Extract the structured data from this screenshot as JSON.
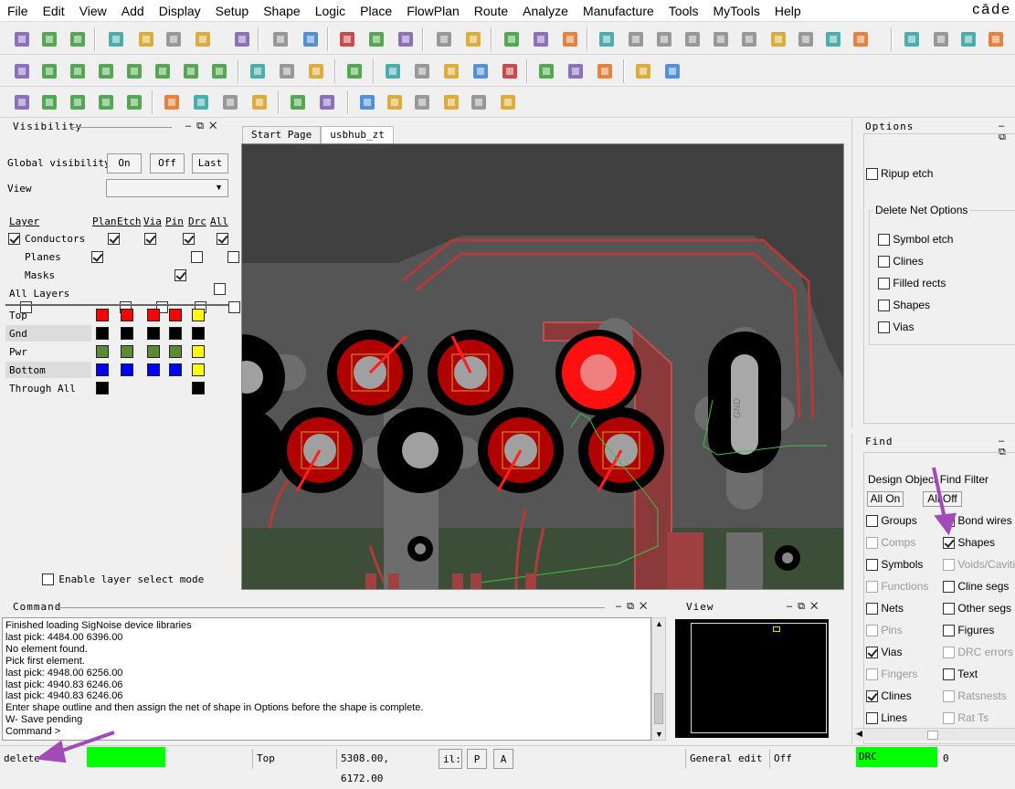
{
  "menu": [
    "File",
    "Edit",
    "View",
    "Add",
    "Display",
    "Setup",
    "Shape",
    "Logic",
    "Place",
    "FlowPlan",
    "Route",
    "Analyze",
    "Manufacture",
    "Tools",
    "MyTools",
    "Help"
  ],
  "brand": "cāde",
  "visibility": {
    "title": "Visibility",
    "global_label": "Global visibility",
    "btn_on": "On",
    "btn_off": "Off",
    "btn_last": "Last",
    "view_label": "View",
    "view_value": "",
    "columns": [
      "Layer",
      "Plan",
      "Etch",
      "Via",
      "Pin",
      "Drc",
      "All"
    ],
    "groups": [
      {
        "label": "Conductors",
        "checked": true,
        "cols": [
          true,
          true,
          true,
          true,
          true,
          true
        ]
      },
      {
        "label": "Planes",
        "checked": true,
        "cols": [
          false,
          false,
          false,
          false,
          false,
          false
        ]
      },
      {
        "label": "Masks",
        "checked": true,
        "cols": [
          false,
          false,
          false,
          false,
          false,
          false
        ]
      },
      {
        "label": "All Layers",
        "checked": false,
        "cols": [
          false,
          false,
          false,
          false,
          false,
          false
        ]
      }
    ],
    "layers": [
      {
        "label": "Top",
        "colors": [
          "#ff0000",
          "#ff0000",
          "#ff0000",
          "#ff0000",
          "#ffff00"
        ],
        "all": true,
        "shaded": false
      },
      {
        "label": "Gnd",
        "colors": [
          "#000000",
          "#000000",
          "#000000",
          "#000000",
          "#000000"
        ],
        "all": false,
        "shaded": true
      },
      {
        "label": "Pwr",
        "colors": [
          "#5a8a32",
          "#5a8a32",
          "#5a8a32",
          "#5a8a32",
          "#ffff00"
        ],
        "all": true,
        "shaded": false
      },
      {
        "label": "Bottom",
        "colors": [
          "#0000ff",
          "#0000ff",
          "#0000ff",
          "#0000ff",
          "#ffff00"
        ],
        "all": true,
        "shaded": true
      },
      {
        "label": "Through All",
        "colors": [
          "#000000",
          null,
          null,
          null,
          "#000000"
        ],
        "all": false,
        "shaded": false
      }
    ],
    "enable_select": "Enable layer select mode"
  },
  "tabs": [
    {
      "label": "Start Page",
      "active": false
    },
    {
      "label": "usbhub_zt",
      "active": true
    }
  ],
  "canvas": {
    "pad_label": "GND"
  },
  "options": {
    "title": "Options",
    "ripup": "Ripup etch",
    "group_title": "Delete Net Options",
    "items": [
      "Symbol etch",
      "Clines",
      "Filled rects",
      "Shapes",
      "Vias"
    ]
  },
  "find": {
    "title": "Find",
    "filter_title": "Design Object Find Filter",
    "all_on": "All On",
    "all_off": "All Off",
    "left": [
      {
        "label": "Groups",
        "checked": false,
        "enabled": true
      },
      {
        "label": "Comps",
        "checked": false,
        "enabled": false
      },
      {
        "label": "Symbols",
        "checked": false,
        "enabled": true
      },
      {
        "label": "Functions",
        "checked": false,
        "enabled": false
      },
      {
        "label": "Nets",
        "checked": false,
        "enabled": true
      },
      {
        "label": "Pins",
        "checked": false,
        "enabled": false
      },
      {
        "label": "Vias",
        "checked": true,
        "enabled": true
      },
      {
        "label": "Fingers",
        "checked": false,
        "enabled": false
      },
      {
        "label": "Clines",
        "checked": true,
        "enabled": true
      },
      {
        "label": "Lines",
        "checked": false,
        "enabled": true
      }
    ],
    "right": [
      {
        "label": "Bond wires",
        "checked": false,
        "enabled": true
      },
      {
        "label": "Shapes",
        "checked": true,
        "enabled": true
      },
      {
        "label": "Voids/Cavitie",
        "checked": false,
        "enabled": false
      },
      {
        "label": "Cline segs",
        "checked": false,
        "enabled": true
      },
      {
        "label": "Other segs",
        "checked": false,
        "enabled": true
      },
      {
        "label": "Figures",
        "checked": false,
        "enabled": true
      },
      {
        "label": "DRC errors",
        "checked": false,
        "enabled": false
      },
      {
        "label": "Text",
        "checked": false,
        "enabled": true
      },
      {
        "label": "Ratsnests",
        "checked": false,
        "enabled": false
      },
      {
        "label": "Rat Ts",
        "checked": false,
        "enabled": false
      }
    ]
  },
  "command": {
    "title": "Command",
    "lines": [
      "Finished loading SigNoise device libraries",
      "last pick:  4484.00 6396.00",
      "No element found.",
      "Pick first element.",
      "last pick:  4948.00 6256.00",
      "last pick:  4940.83 6246.06",
      "last pick:  4940.83 6246.06",
      "Enter shape outline and then assign the net of shape in Options before the shape is complete.",
      "W- Save pending",
      "Command >"
    ]
  },
  "viewpanel": {
    "title": "View"
  },
  "status": {
    "command": "delete",
    "layer": "Top",
    "coords": "5308.00, 6172.00",
    "il": "il:",
    "p": "P",
    "a": "A",
    "mode": "General edit",
    "off": "Off",
    "drc": "DRC",
    "drc_count": "0"
  },
  "colors": {
    "accent_arrow": "#a24ab8",
    "status_green": "#00ff00"
  }
}
